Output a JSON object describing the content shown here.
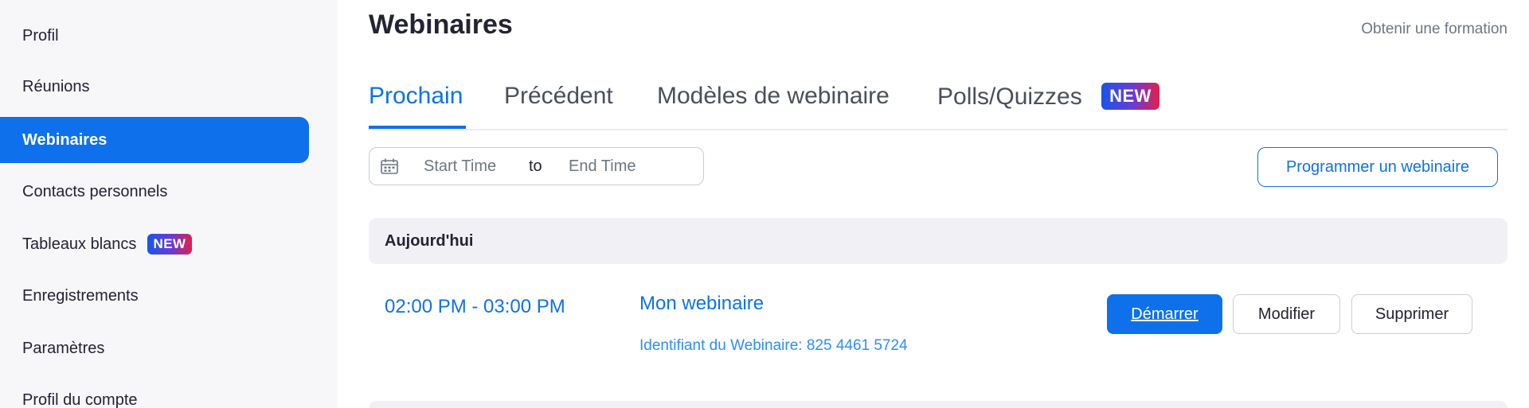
{
  "sidebar": {
    "items": [
      {
        "label": "Profil"
      },
      {
        "label": "Réunions"
      },
      {
        "label": "Webinaires"
      },
      {
        "label": "Contacts personnels"
      },
      {
        "label": "Tableaux blancs",
        "badge": "NEW"
      },
      {
        "label": "Enregistrements"
      },
      {
        "label": "Paramètres"
      },
      {
        "label": "Profil du compte"
      }
    ],
    "active_item": "Webinaires"
  },
  "header": {
    "title": "Webinaires",
    "training_link": "Obtenir une formation"
  },
  "tabs": [
    {
      "label": "Prochain"
    },
    {
      "label": "Précédent"
    },
    {
      "label": "Modèles de webinaire"
    },
    {
      "label": "Polls/Quizzes",
      "badge": "NEW"
    }
  ],
  "active_tab": "Prochain",
  "filter": {
    "start_placeholder": "Start Time",
    "separator": "to",
    "end_placeholder": "End Time"
  },
  "schedule_button": "Programmer un webinaire",
  "section": {
    "title": "Aujourd'hui"
  },
  "webinar": {
    "time": "02:00 PM - 03:00 PM",
    "title": "Mon webinaire",
    "id_line": "Identifiant du Webinaire: 825 4461 5724",
    "actions": {
      "start": "Démarrer",
      "edit": "Modifier",
      "delete": "Supprimer"
    }
  },
  "colors": {
    "accent": "#0e71eb",
    "link": "#2d8cff",
    "sidebar_bg": "#f7f7fa",
    "section_bg": "#f1f1f5"
  }
}
